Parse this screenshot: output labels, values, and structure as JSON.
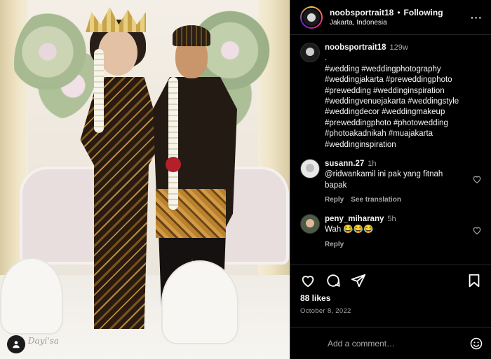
{
  "post": {
    "username": "noobsportrait18",
    "separator": "•",
    "follow_label": "Following",
    "location": "Jakarta, Indonesia",
    "more_label": "···",
    "photo_signature": "Dayi'sa"
  },
  "caption": {
    "username": "noobsportrait18",
    "time": "129w",
    "text": ".\n#wedding #weddingphotography\n#weddingjakarta #preweddingphoto\n#prewedding #weddinginspiration\n#weddingvenuejakarta #weddingstyle\n#weddingdecor #weddingmakeup\n#preweddingphoto #photowedding\n#photoakadnikah #muajakarta\n#weddinginspiration"
  },
  "comments": [
    {
      "username": "susann.27",
      "time": "1h",
      "text": "@ridwankamil ini pak yang fitnah bapak",
      "reply_label": "Reply",
      "translate_label": "See translation"
    },
    {
      "username": "peny_miharany",
      "time": "5h",
      "text": "Wah 😂😂😂",
      "reply_label": "Reply"
    }
  ],
  "footer": {
    "likes": "88 likes",
    "date": "October 8, 2022",
    "comment_placeholder": "Add a comment…"
  },
  "icons": {
    "like": "heart-icon",
    "comment": "comment-icon",
    "share": "share-icon",
    "save": "bookmark-icon",
    "emoji": "emoji-icon",
    "tag": "user-tag-icon"
  }
}
